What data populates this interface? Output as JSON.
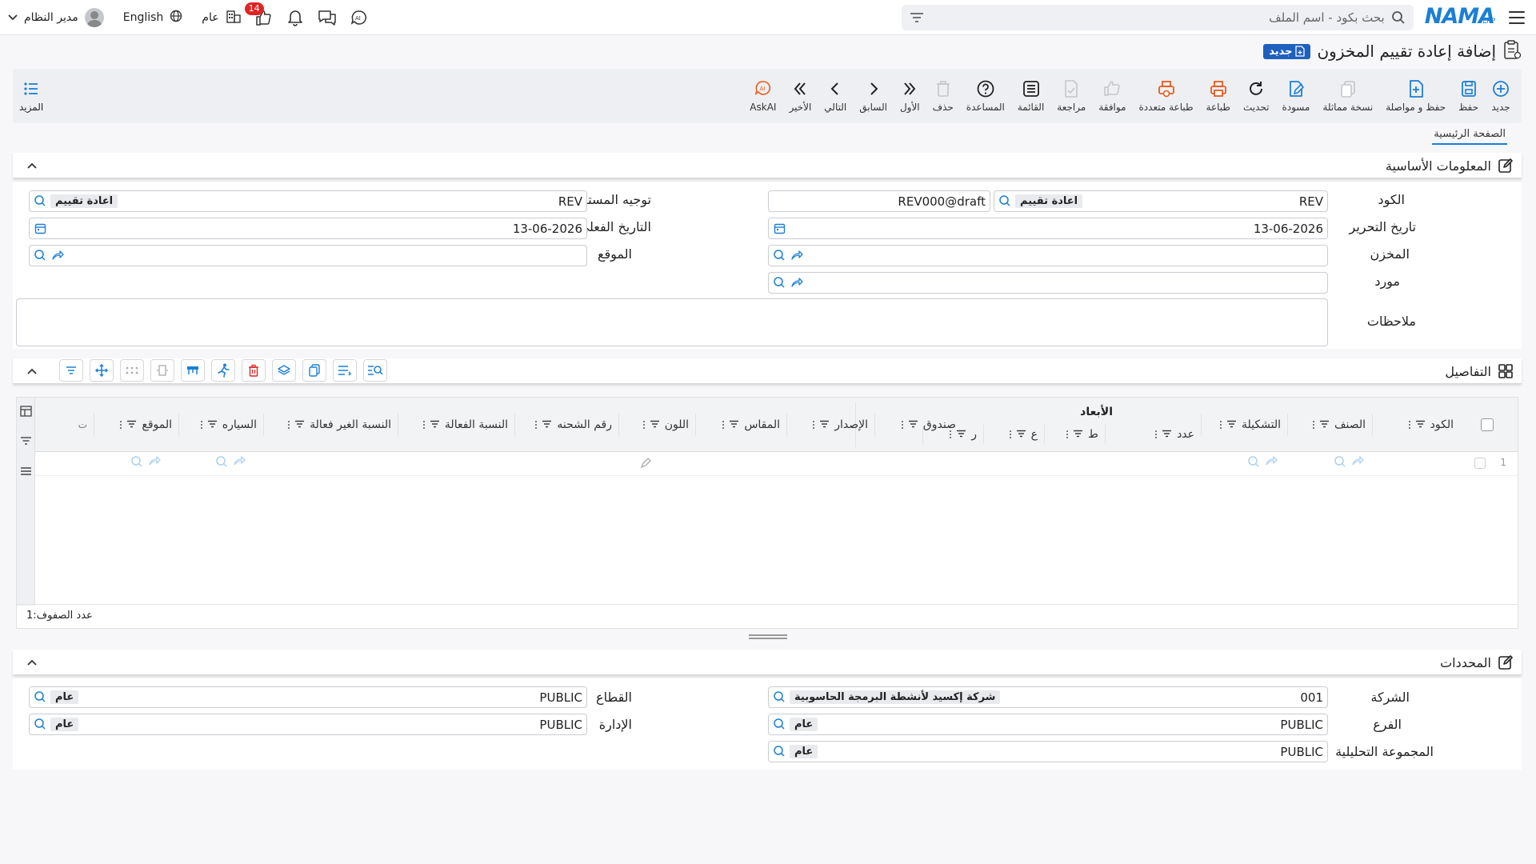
{
  "topbar": {
    "logo_text": "NAMA",
    "logo_sub": "ERP",
    "search_placeholder": "بحث بكود - اسم الملف",
    "user_name": "مدير النظام",
    "language": "English",
    "scope": "عام",
    "notification_count": "14"
  },
  "page": {
    "title": "إضافة إعادة تقييم المخزون",
    "status_tag": "جديد"
  },
  "toolbar": {
    "buttons": [
      {
        "label": "جديد",
        "icon": "plus-circle-icon"
      },
      {
        "label": "حفظ",
        "icon": "save-icon"
      },
      {
        "label": "حفظ و مواصلة",
        "icon": "save-continue-icon"
      },
      {
        "label": "نسخة مماثلة",
        "icon": "copy-icon"
      },
      {
        "label": "مسودة",
        "icon": "draft-icon"
      },
      {
        "label": "تحديث",
        "icon": "refresh-icon"
      },
      {
        "label": "طباعة",
        "icon": "print-icon"
      },
      {
        "label": "طباعة متعددة",
        "icon": "multi-print-icon"
      },
      {
        "label": "موافقة",
        "icon": "approve-icon"
      },
      {
        "label": "مراجعة",
        "icon": "review-icon"
      },
      {
        "label": "القائمة",
        "icon": "list-icon"
      },
      {
        "label": "المساعدة",
        "icon": "help-icon"
      },
      {
        "label": "حذف",
        "icon": "delete-icon"
      },
      {
        "label": "الأول",
        "icon": "first-icon"
      },
      {
        "label": "السابق",
        "icon": "previous-icon"
      },
      {
        "label": "التالي",
        "icon": "next-icon"
      },
      {
        "label": "الأخير",
        "icon": "last-icon"
      },
      {
        "label": "AskAI",
        "icon": "askai-icon"
      }
    ],
    "more_label": "المزيد"
  },
  "tabs": {
    "main": "الصفحة الرئيسية"
  },
  "basic_info": {
    "section_title": "المعلومات الأساسية",
    "code_label": "الكود",
    "code_value": "REV",
    "code_chip": "اعادة تقييم",
    "code_number": "REV000@draft",
    "doc_direction_label": "توجيه المستند",
    "doc_direction_value": "REV",
    "doc_direction_chip": "اعادة تقييم",
    "edit_date_label": "تاريخ التحرير",
    "edit_date_value": "13-06-2026",
    "actual_date_label": "التاريخ الفعلي",
    "actual_date_value": "13-06-2026",
    "warehouse_label": "المخزن",
    "location_label": "الموقع",
    "supplier_label": "مورد",
    "notes_label": "ملاحظات"
  },
  "details": {
    "section_title": "التفاصيل",
    "dimensions_header": "الأبعاد",
    "columns": [
      "الكود",
      "الصنف",
      "التشكيلة",
      "صندوق",
      "الإصدار",
      "المقاس",
      "اللون",
      "رقم الشحنه",
      "النسبة الفعالة",
      "النسبة الغير فعالة",
      "السياره",
      "الموقع",
      "ت"
    ],
    "dimension_subcolumns": [
      "عدد",
      "ط",
      "ع",
      "ر"
    ],
    "row_number": "1",
    "row_count_label": "عدد الصفوف:",
    "row_count": "1"
  },
  "determinants": {
    "section_title": "المحددات",
    "company_label": "الشركة",
    "company_value": "001",
    "company_chip": "شركة إكسيد لأنشطة البرمجة الحاسوبية",
    "sector_label": "القطاع",
    "sector_value": "PUBLIC",
    "sector_chip": "عام",
    "branch_label": "الفرع",
    "branch_value": "PUBLIC",
    "branch_chip": "عام",
    "department_label": "الإدارة",
    "department_value": "PUBLIC",
    "department_chip": "عام",
    "analytic_label": "المجموعة التحليلية",
    "analytic_value": "PUBLIC",
    "analytic_chip": "عام"
  }
}
